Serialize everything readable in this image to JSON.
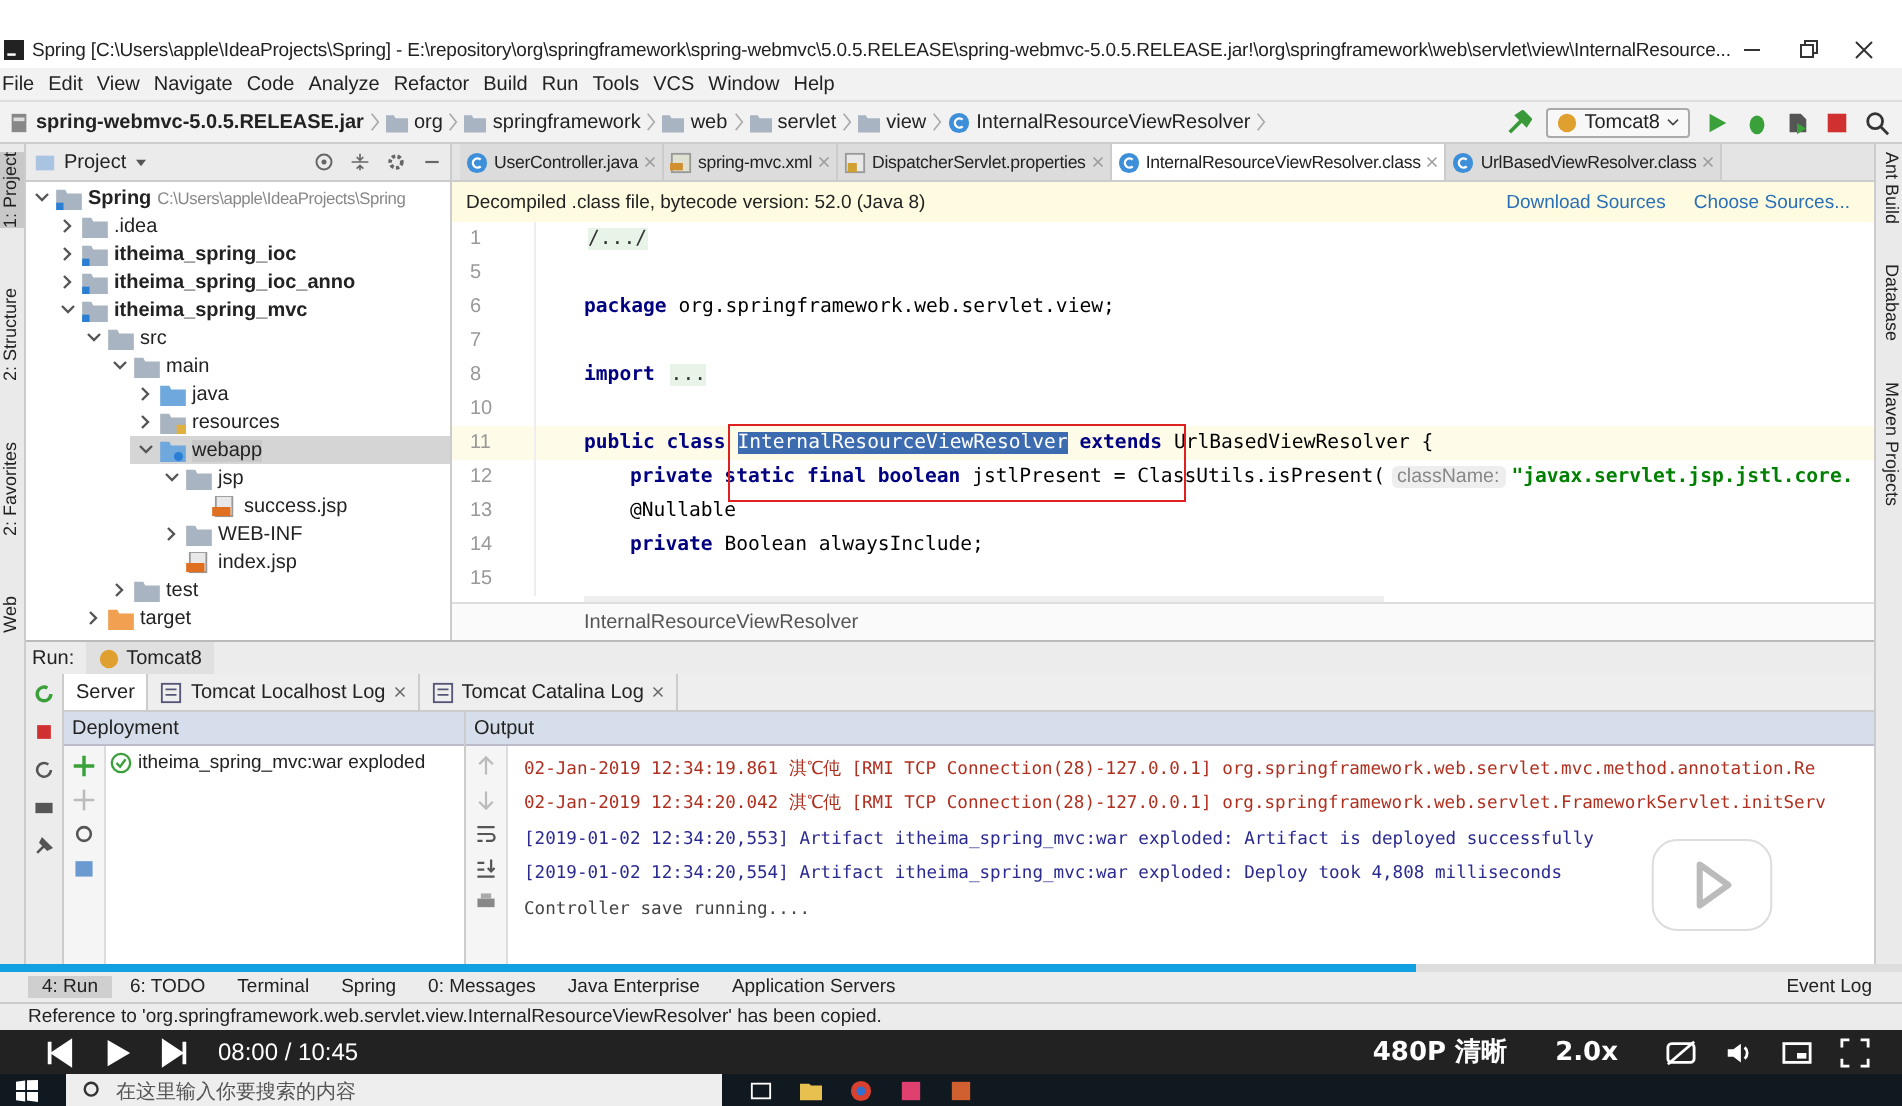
{
  "window": {
    "title": "Spring [C:\\Users\\apple\\IdeaProjects\\Spring] - E:\\repository\\org\\springframework\\spring-webmvc\\5.0.5.RELEASE\\spring-webmvc-5.0.5.RELEASE.jar!\\org\\springframework\\web\\servlet\\view\\InternalResource..."
  },
  "menu": [
    "File",
    "Edit",
    "View",
    "Navigate",
    "Code",
    "Analyze",
    "Refactor",
    "Build",
    "Run",
    "Tools",
    "VCS",
    "Window",
    "Help"
  ],
  "breadcrumb": [
    {
      "label": "spring-webmvc-5.0.5.RELEASE.jar",
      "kind": "jar"
    },
    {
      "label": "org",
      "kind": "package"
    },
    {
      "label": "springframework",
      "kind": "package"
    },
    {
      "label": "web",
      "kind": "package"
    },
    {
      "label": "servlet",
      "kind": "package"
    },
    {
      "label": "view",
      "kind": "package"
    },
    {
      "label": "InternalResourceViewResolver",
      "kind": "class"
    }
  ],
  "run_config": "Tomcat8",
  "left_strip": [
    "1: Project",
    "2: Structure",
    "2: Favorites",
    "Web"
  ],
  "right_strip": [
    "Ant Build",
    "Database",
    "Maven Projects"
  ],
  "project": {
    "title": "Project",
    "tree": [
      {
        "label": "Spring",
        "kind": "module",
        "path": "C:\\Users\\apple\\IdeaProjects\\Spring",
        "expanded": true,
        "selected": false,
        "children": [
          {
            "label": ".idea",
            "kind": "folder",
            "expanded": false,
            "selected": false
          },
          {
            "label": "itheima_spring_ioc",
            "kind": "module",
            "expanded": false,
            "selected": false
          },
          {
            "label": "itheima_spring_ioc_anno",
            "kind": "module",
            "expanded": false,
            "selected": false
          },
          {
            "label": "itheima_spring_mvc",
            "kind": "module",
            "expanded": true,
            "selected": false,
            "children": [
              {
                "label": "src",
                "kind": "folder",
                "expanded": true,
                "selected": false,
                "children": [
                  {
                    "label": "main",
                    "kind": "folder",
                    "expanded": true,
                    "selected": false,
                    "children": [
                      {
                        "label": "java",
                        "kind": "source",
                        "expanded": false,
                        "selected": false
                      },
                      {
                        "label": "resources",
                        "kind": "resources",
                        "expanded": false,
                        "selected": false
                      },
                      {
                        "label": "webapp",
                        "kind": "web",
                        "expanded": true,
                        "selected": true,
                        "children": [
                          {
                            "label": "jsp",
                            "kind": "folder",
                            "expanded": true,
                            "selected": false,
                            "children": [
                              {
                                "label": "success.jsp",
                                "kind": "jsp",
                                "selected": false
                              }
                            ]
                          },
                          {
                            "label": "WEB-INF",
                            "kind": "folder",
                            "expanded": false,
                            "selected": false
                          },
                          {
                            "label": "index.jsp",
                            "kind": "jsp",
                            "selected": false
                          }
                        ]
                      }
                    ]
                  },
                  {
                    "label": "test",
                    "kind": "folder",
                    "expanded": false,
                    "selected": false
                  }
                ]
              },
              {
                "label": "target",
                "kind": "excluded",
                "expanded": false,
                "selected": false
              }
            ]
          }
        ]
      }
    ]
  },
  "editor_tabs": [
    {
      "label": "UserController.java",
      "kind": "class",
      "selected": false
    },
    {
      "label": "spring-mvc.xml",
      "kind": "xml",
      "selected": false
    },
    {
      "label": "DispatcherServlet.properties",
      "kind": "properties",
      "selected": false
    },
    {
      "label": "InternalResourceViewResolver.class",
      "kind": "class",
      "selected": true
    },
    {
      "label": "UrlBasedViewResolver.class",
      "kind": "class",
      "selected": false
    }
  ],
  "notice": {
    "text": "Decompiled .class file, bytecode version: 52.0 (Java 8)",
    "links": [
      "Download Sources",
      "Choose Sources..."
    ]
  },
  "code": [
    {
      "number": "1",
      "kind": "top",
      "current": false,
      "tokens": [
        {
          "kind": "folded",
          "text": "/.../"
        }
      ]
    },
    {
      "number": "5",
      "kind": "top",
      "current": false
    },
    {
      "number": "6",
      "kind": "top",
      "current": false,
      "tokens": [
        {
          "kind": "keyword",
          "text": "package "
        },
        {
          "kind": "plain",
          "text": "org.springframework.web.servlet.view;"
        }
      ]
    },
    {
      "number": "7",
      "kind": "top",
      "current": false
    },
    {
      "number": "8",
      "kind": "top",
      "current": false,
      "tokens": [
        {
          "kind": "keyword",
          "text": "import "
        },
        {
          "kind": "folded",
          "text": "..."
        }
      ]
    },
    {
      "number": "10",
      "kind": "top",
      "current": false
    },
    {
      "number": "11",
      "kind": "top",
      "current": true,
      "tokens": [
        {
          "kind": "keyword",
          "text": "public class "
        },
        {
          "kind": "selected",
          "text": "InternalResourceViewResolver"
        },
        {
          "kind": "keyword",
          "text": " extends "
        },
        {
          "kind": "plain",
          "text": "UrlBasedViewResolver {"
        }
      ]
    },
    {
      "number": "12",
      "kind": "member",
      "current": false,
      "tokens": [
        {
          "kind": "keyword",
          "text": "private static final boolean "
        },
        {
          "kind": "plain",
          "text": "jstlPresent = ClassUtils.isPresent("
        },
        {
          "kind": "hint",
          "text": "className:"
        },
        {
          "kind": "string",
          "text": "\"javax.servlet.jsp.jstl.core."
        }
      ]
    },
    {
      "number": "13",
      "kind": "member",
      "current": false,
      "tokens": [
        {
          "kind": "plain",
          "text": "@Nullable"
        }
      ]
    },
    {
      "number": "14",
      "kind": "member",
      "current": false,
      "tokens": [
        {
          "kind": "keyword",
          "text": "private "
        },
        {
          "kind": "plain",
          "text": "Boolean alwaysInclude;"
        }
      ]
    },
    {
      "number": "15",
      "kind": "top",
      "current": false
    }
  ],
  "editor_footer": "InternalResourceViewResolver",
  "run": {
    "label": "Run:",
    "config": "Tomcat8",
    "tabs": [
      {
        "label": "Server",
        "selected": true
      },
      {
        "label": "Tomcat Localhost Log",
        "selected": false
      },
      {
        "label": "Tomcat Catalina Log",
        "selected": false
      }
    ],
    "deployment_header": "Deployment",
    "output_header": "Output",
    "deployment": [
      {
        "label": "itheima_spring_mvc:war exploded"
      }
    ],
    "output": [
      {
        "kind": "log",
        "text": "02-Jan-2019 12:34:19.861 淇℃伅 [RMI TCP Connection(28)-127.0.0.1] org.springframework.web.servlet.mvc.method.annotation.Re"
      },
      {
        "kind": "log",
        "text": "02-Jan-2019 12:34:20.042 淇℃伅 [RMI TCP Connection(28)-127.0.0.1] org.springframework.web.servlet.FrameworkServlet.initServ"
      },
      {
        "kind": "info",
        "text": "[2019-01-02 12:34:20,553] Artifact itheima_spring_mvc:war exploded: Artifact is deployed successfully"
      },
      {
        "kind": "info",
        "text": "[2019-01-02 12:34:20,554] Artifact itheima_spring_mvc:war exploded: Deploy took 4,808 milliseconds"
      },
      {
        "kind": "plain",
        "text": "Controller save running...."
      }
    ]
  },
  "tool_tabs": [
    {
      "label": "4: Run",
      "selected": true
    },
    {
      "label": "6: TODO",
      "selected": false
    },
    {
      "label": "Terminal",
      "selected": false
    },
    {
      "label": "Spring",
      "selected": false
    },
    {
      "label": "0: Messages",
      "selected": false
    },
    {
      "label": "Java Enterprise",
      "selected": false
    },
    {
      "label": "Application Servers",
      "selected": false
    }
  ],
  "event_log": "Event Log",
  "status": "Reference to 'org.springframework.web.servlet.view.InternalResourceViewResolver' has been copied.",
  "player": {
    "level": 0.745,
    "time": "08:00 / 10:45",
    "quality": "480P",
    "quality_name": "清晰",
    "speed": "2.0x"
  },
  "taskbar": {
    "search_placeholder": "在这里输入你要搜索的内容"
  }
}
